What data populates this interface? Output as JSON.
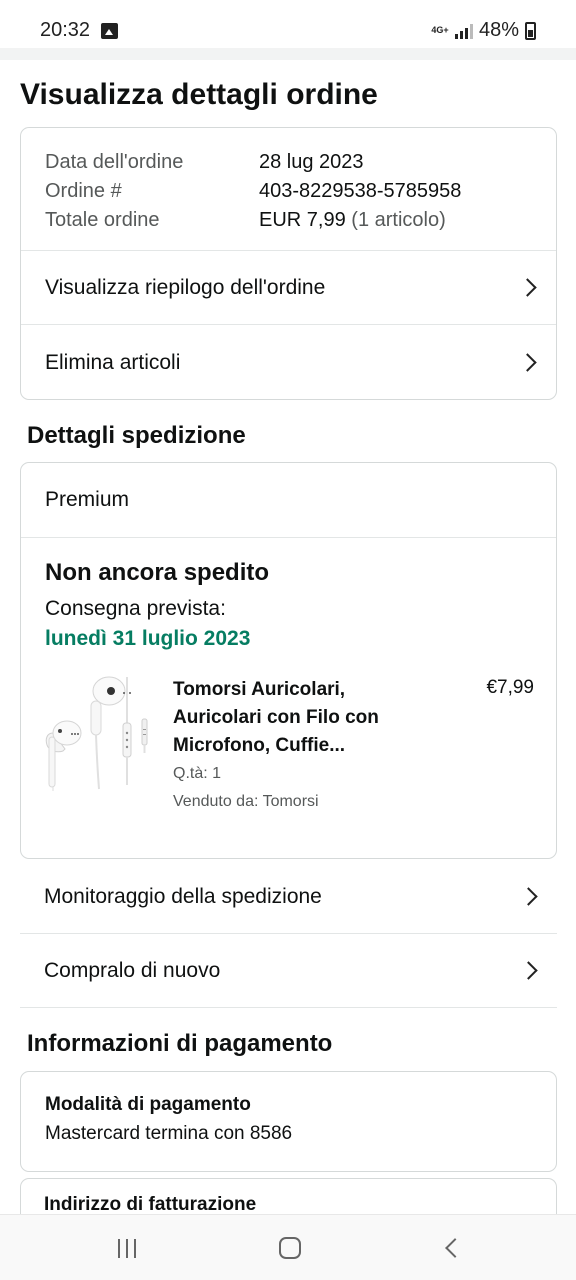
{
  "status_bar": {
    "time": "20:32",
    "network": "4G+",
    "battery": "48%",
    "icons": [
      "gallery-icon",
      "network-4g-icon",
      "signal-icon",
      "battery-icon"
    ]
  },
  "page": {
    "title": "Visualizza dettagli ordine"
  },
  "order_summary": {
    "rows": [
      {
        "label": "Data dell'ordine",
        "value": "28 lug 2023"
      },
      {
        "label": "Ordine #",
        "value": "403-8229538-5785958"
      },
      {
        "label": "Totale ordine",
        "value": "EUR 7,99",
        "value_suffix": "(1 articolo)"
      }
    ],
    "links": [
      {
        "label": "Visualizza riepilogo dell'ordine"
      },
      {
        "label": "Elimina articoli"
      }
    ]
  },
  "shipping": {
    "section_title": "Dettagli spedizione",
    "service": "Premium",
    "status": "Non ancora spedito",
    "delivery_label": "Consegna prevista:",
    "delivery_date": "lunedì 31 luglio 2023",
    "delivery_color": "#067d62",
    "product": {
      "title": "Tomorsi Auricolari, Auricolari con Filo con Microfono, Cuffie...",
      "price": "€7,99",
      "quantity": "Q.tà: 1",
      "seller": "Venduto da: Tomorsi"
    },
    "actions": [
      {
        "label": "Monitoraggio della spedizione"
      },
      {
        "label": "Compralo di nuovo"
      }
    ]
  },
  "payment": {
    "section_title": "Informazioni di pagamento",
    "method_label": "Modalità di pagamento",
    "method_value": "Mastercard  termina con 8586",
    "billing_label": "Indirizzo di fatturazione"
  }
}
